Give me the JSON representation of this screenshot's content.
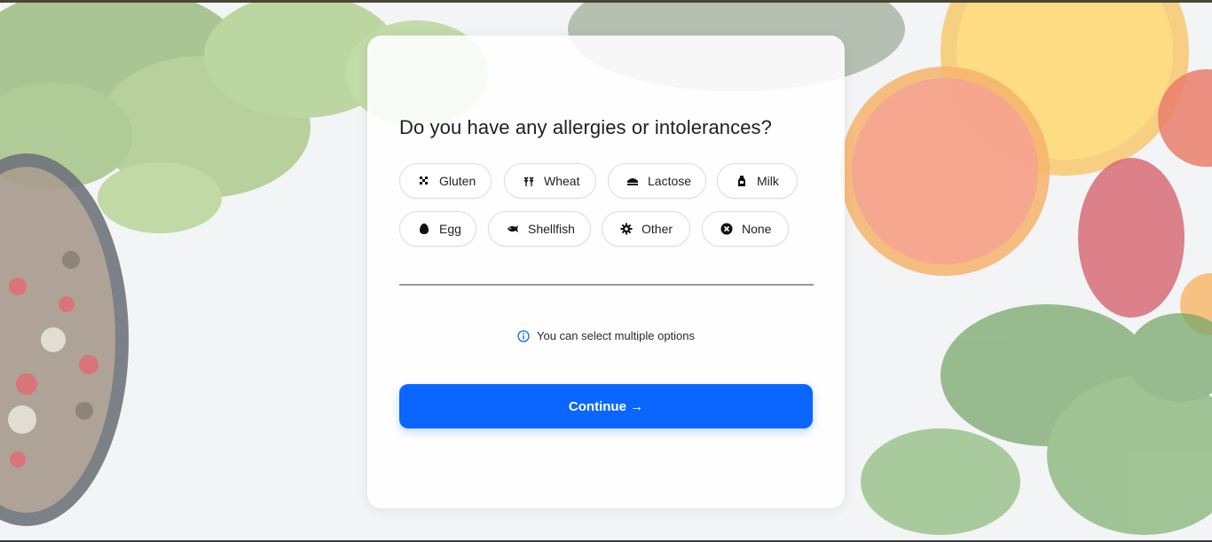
{
  "question": {
    "title": "Do you have any allergies or intolerances?"
  },
  "options": [
    {
      "label": "Gluten",
      "icon": "gluten-icon"
    },
    {
      "label": "Wheat",
      "icon": "wheat-icon"
    },
    {
      "label": "Lactose",
      "icon": "lactose-icon"
    },
    {
      "label": "Milk",
      "icon": "milk-icon"
    },
    {
      "label": "Egg",
      "icon": "egg-icon"
    },
    {
      "label": "Shellfish",
      "icon": "fish-icon"
    },
    {
      "label": "Other",
      "icon": "gear-icon"
    },
    {
      "label": "None",
      "icon": "close-circle-icon"
    }
  ],
  "hint": {
    "text": "You can select multiple options",
    "icon": "info-icon"
  },
  "actions": {
    "continue_label": "Continue →"
  },
  "colors": {
    "accent": "#0a66ff",
    "info": "#0a66ff"
  }
}
